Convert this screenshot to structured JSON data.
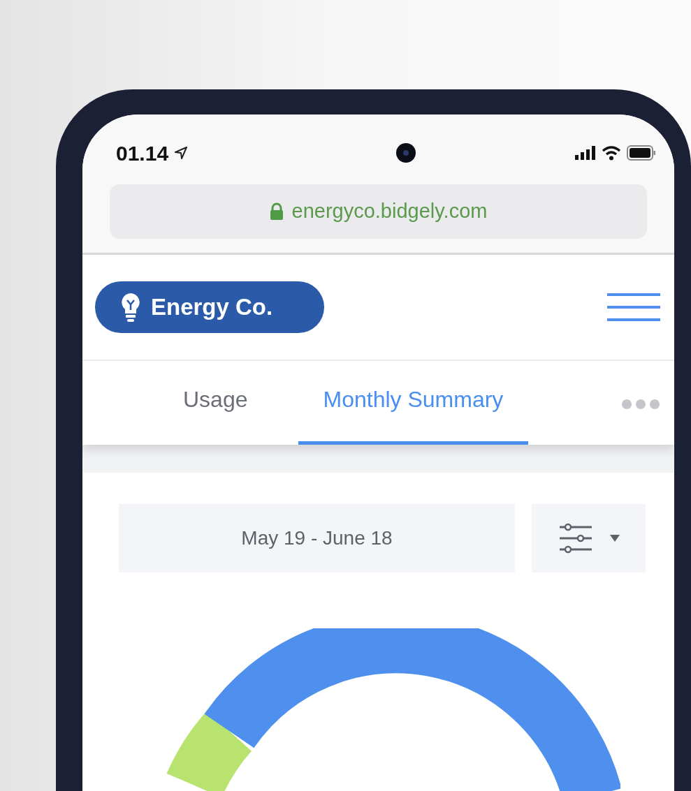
{
  "status_bar": {
    "time": "01.14"
  },
  "address_bar": {
    "url": "energyco.bidgely.com"
  },
  "header": {
    "brand": "Energy Co."
  },
  "tabs": [
    {
      "label": "Usage",
      "selected": false
    },
    {
      "label": "Monthly Summary",
      "selected": true
    }
  ],
  "date_range": {
    "value": "May 19 - June 18"
  }
}
